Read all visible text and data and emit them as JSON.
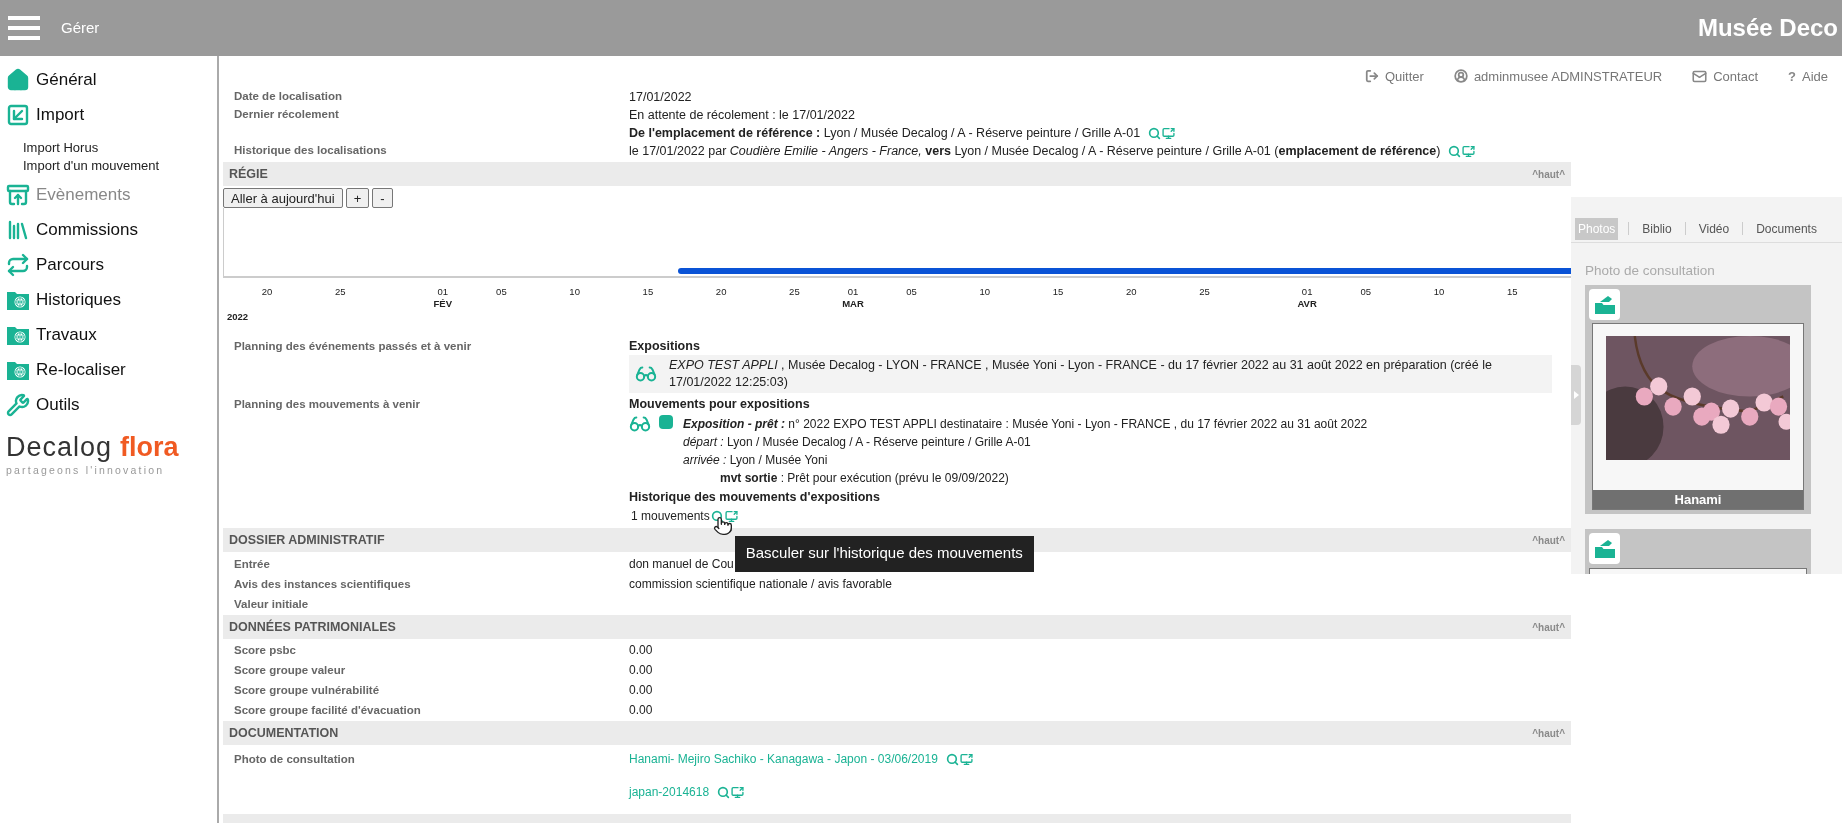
{
  "header": {
    "menu_label": "Gérer",
    "title": "Musée Deco"
  },
  "sidebar": {
    "items": [
      {
        "label": "Général",
        "kind": "home",
        "disabled": false
      },
      {
        "label": "Import",
        "kind": "import",
        "disabled": false,
        "children": [
          {
            "label": "Import Horus"
          },
          {
            "label": "Import d'un mouvement"
          }
        ]
      },
      {
        "label": "Evènements",
        "kind": "archive",
        "disabled": true
      },
      {
        "label": "Commissions",
        "kind": "books",
        "disabled": false
      },
      {
        "label": "Parcours",
        "kind": "swap",
        "disabled": false
      },
      {
        "label": "Historiques",
        "kind": "folder",
        "disabled": false
      },
      {
        "label": "Travaux",
        "kind": "folder",
        "disabled": false
      },
      {
        "label": "Re-localiser",
        "kind": "folder",
        "disabled": false
      },
      {
        "label": "Outils",
        "kind": "wrench",
        "disabled": false
      }
    ],
    "logo": {
      "brand": "Decalog",
      "product": "flora",
      "tagline": "partageons l'innovation"
    }
  },
  "top_links": [
    {
      "kind": "logout",
      "label": "Quitter"
    },
    {
      "kind": "user",
      "label": "adminmusee ADMINSTRATEUR"
    },
    {
      "kind": "contact",
      "label": "Contact"
    },
    {
      "kind": "help",
      "icon": "?",
      "label": "Aide"
    }
  ],
  "localisation": {
    "rows": [
      {
        "label": "Date de localisation",
        "lines": [
          {
            "text": "17/01/2022",
            "actions": false
          }
        ]
      },
      {
        "label": "Dernier récolement",
        "lines": [
          {
            "text": "En attente de récolement : le 17/01/2022",
            "actions": false
          },
          {
            "text": "**De l'emplacement de référence :** Lyon / Musée Decalog / A - Réserve peinture / Grille A-01",
            "actions": true
          }
        ]
      },
      {
        "label": "Historique des localisations",
        "lines": [
          {
            "text": "le 17/01/2022 par *Coudière Emilie - Angers - France,*  **vers** Lyon / Musée Decalog / A - Réserve peinture / Grille A-01  (**emplacement de référence**)",
            "actions": true
          }
        ]
      }
    ]
  },
  "regie": {
    "title": "RÉGIE",
    "top_link": "^haut^",
    "buttons": [
      "Aller à aujourd'hui",
      "+",
      "-"
    ],
    "timeline": {
      "year": "2022",
      "ticks": [
        {
          "label": "20"
        },
        {
          "label": "25"
        },
        {
          "label": "01",
          "month": "FÉV"
        },
        {
          "label": "05"
        },
        {
          "label": "10"
        },
        {
          "label": "15"
        },
        {
          "label": "20"
        },
        {
          "label": "25"
        },
        {
          "label": "01",
          "month": "MAR"
        },
        {
          "label": "05"
        },
        {
          "label": "10"
        },
        {
          "label": "15"
        },
        {
          "label": "20"
        },
        {
          "label": "25"
        },
        {
          "label": "01",
          "month": "AVR"
        },
        {
          "label": "05"
        },
        {
          "label": "10"
        },
        {
          "label": "15"
        }
      ]
    },
    "events": {
      "label": "Planning des événements passés et à venir",
      "heading": "Expositions",
      "items": [
        {
          "text": "*EXPO TEST APPLI* , Musée Decalog - LYON - FRANCE ,  Musée Yoni - Lyon - FRANCE - du 17 février 2022 au 31 août 2022  en préparation (créé le 17/01/2022 12:25:03)"
        }
      ]
    },
    "movements": {
      "label": "Planning des mouvements à venir",
      "heading": "Mouvements pour expositions",
      "items": [
        {
          "color": "#1ab394",
          "type_label": "Exposition - prêt :",
          "lines": [
            "n° 2022 EXPO TEST APPLI destinataire : Musée Yoni - Lyon - FRANCE , du 17 février 2022 au 31 août 2022",
            "*départ :* Lyon / Musée Decalog / A - Réserve peinture / Grille A-01",
            "*arrivée :* Lyon / Musée Yoni"
          ],
          "status": "**mvt sortie** : Prêt pour exécution (prévu le 09/09/2022)"
        }
      ]
    },
    "history": {
      "heading": "Historique des mouvements d'expositions",
      "count": "1 mouvements",
      "tooltip": "Basculer sur l'historique des mouvements"
    }
  },
  "dossier": {
    "title": "DOSSIER ADMINISTRATIF",
    "top_link": "^haut^",
    "rows": [
      {
        "label": "Entrée",
        "value": "don manuel de Cou"
      },
      {
        "label": "Avis des instances scientifiques",
        "value": "commission scientifique nationale / avis favorable"
      },
      {
        "label": "Valeur initiale"
      }
    ]
  },
  "patrimoine": {
    "title": "DONNÉES PATRIMONIALES",
    "top_link": "^haut^",
    "rows": [
      {
        "label": "Score psbc",
        "value": "0.00"
      },
      {
        "label": "Score groupe valeur",
        "value": "0.00"
      },
      {
        "label": "Score groupe vulnérabilité",
        "value": "0.00"
      },
      {
        "label": "Score groupe facilité d'évacuation",
        "value": "0.00"
      }
    ]
  },
  "documentation": {
    "title": "DOCUMENTATION",
    "top_link": "^haut^",
    "rows": [
      {
        "label": "Photo de consultation",
        "links": [
          "Hanami- Mejiro Sachiko - Kanagawa - Japon - 03/06/2019",
          "japan-2014618"
        ]
      }
    ]
  },
  "media_panel": {
    "tabs": [
      {
        "label": "Photos",
        "selected": true
      },
      {
        "label": "Biblio",
        "selected": false
      },
      {
        "label": "Vidéo",
        "selected": false
      },
      {
        "label": "Documents",
        "selected": false
      }
    ],
    "section_label": "Photo de consultation",
    "photo": {
      "caption": "Hanami"
    }
  }
}
